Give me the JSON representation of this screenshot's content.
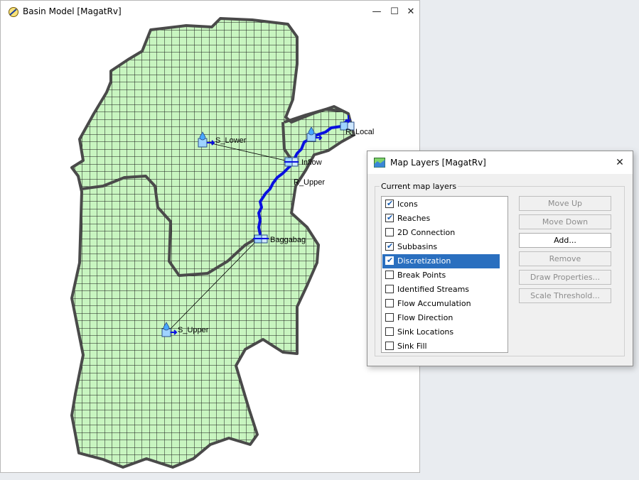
{
  "basin_window": {
    "title": "Basin Model [MagatRv]",
    "controls": {
      "minimize": "—",
      "maximize": "☐",
      "close": "✕"
    },
    "elements": {
      "s_lower": "S_Lower",
      "inflow": "Inflow",
      "r_upper": "R_Upper",
      "baggabag": "Baggabag",
      "s_upper": "S_Upper",
      "r_local": "R_Local"
    },
    "colors": {
      "subbasin_fill": "#c8f5c0",
      "grid": "#1a1a1a",
      "outline": "#4a4a4a",
      "reach": "#0a10e0"
    }
  },
  "layers_dialog": {
    "title": "Map Layers [MagatRv]",
    "close": "✕",
    "group_label": "Current map layers",
    "layers": [
      {
        "label": "Icons",
        "checked": true,
        "selected": false
      },
      {
        "label": "Reaches",
        "checked": true,
        "selected": false
      },
      {
        "label": "2D Connection",
        "checked": false,
        "selected": false
      },
      {
        "label": "Subbasins",
        "checked": true,
        "selected": false
      },
      {
        "label": "Discretization",
        "checked": true,
        "selected": true
      },
      {
        "label": "Break Points",
        "checked": false,
        "selected": false
      },
      {
        "label": "Identified Streams",
        "checked": false,
        "selected": false
      },
      {
        "label": "Flow Accumulation",
        "checked": false,
        "selected": false
      },
      {
        "label": "Flow Direction",
        "checked": false,
        "selected": false
      },
      {
        "label": "Sink Locations",
        "checked": false,
        "selected": false
      },
      {
        "label": "Sink Fill",
        "checked": false,
        "selected": false
      }
    ],
    "buttons": {
      "move_up": "Move Up",
      "move_down": "Move Down",
      "add": "Add...",
      "remove": "Remove",
      "draw_properties": "Draw Properties...",
      "scale_threshold": "Scale Threshold..."
    },
    "colors": {
      "selection": "#2a6fbf"
    }
  }
}
